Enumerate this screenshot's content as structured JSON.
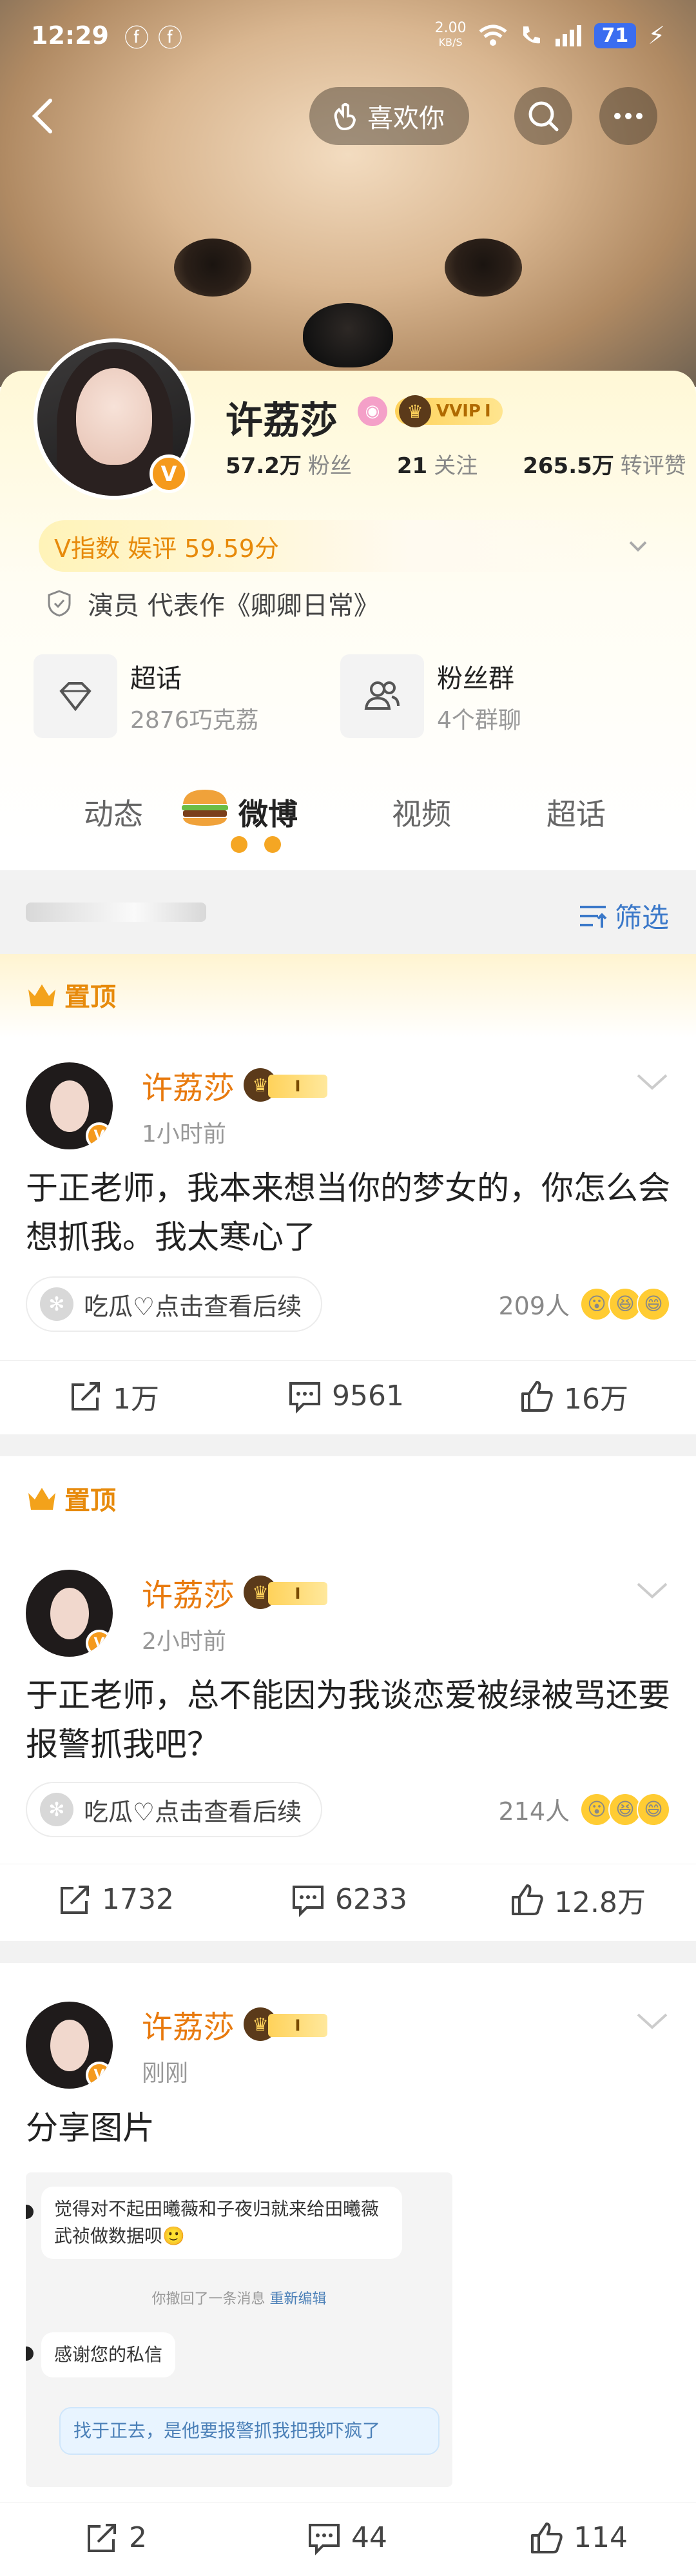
{
  "status_bar": {
    "time": "12:29",
    "net_speed": "2.00",
    "net_unit": "KB/S",
    "battery": "71"
  },
  "top_nav": {
    "like_label": "喜欢你"
  },
  "profile": {
    "name": "许荔莎",
    "vip_label": "VVIP",
    "vip_level": "I",
    "followers_count": "57.2万",
    "followers_label": "粉丝",
    "following_count": "21",
    "following_label": "关注",
    "likes_count": "265.5万",
    "likes_label": "转评赞",
    "v_index": "V指数 娱评 59.59分",
    "occupation": "演员 代表作《卿卿日常》",
    "supertopic": {
      "title": "超话",
      "sub": "2876巧克荔"
    },
    "fangroup": {
      "title": "粉丝群",
      "sub": "4个群聊"
    }
  },
  "tabs": [
    {
      "label": "动态"
    },
    {
      "label": "微博"
    },
    {
      "label": "视频"
    },
    {
      "label": "超话"
    }
  ],
  "filter_label": "筛选",
  "pinned_label": "置顶",
  "posts": [
    {
      "pinned": true,
      "user": "许荔莎",
      "level": "I",
      "time": "1小时前",
      "text": "于正老师，我本来想当你的梦女的，你怎么会想抓我。我太寒心了",
      "melon": "吃瓜♡点击查看后续",
      "reactors": "209人",
      "shares": "1万",
      "comments": "9561",
      "likes": "16万"
    },
    {
      "pinned": true,
      "user": "许荔莎",
      "level": "I",
      "time": "2小时前",
      "text": "于正老师，总不能因为我谈恋爱被绿被骂还要报警抓我吧？",
      "melon": "吃瓜♡点击查看后续",
      "reactors": "214人",
      "shares": "1732",
      "comments": "6233",
      "likes": "12.8万"
    },
    {
      "pinned": false,
      "user": "许荔莎",
      "level": "I",
      "time": "刚刚",
      "text": "分享图片",
      "shares": "2",
      "comments": "44",
      "likes": "114"
    }
  ],
  "shared_image": {
    "msg1": "觉得对不起田曦薇和子夜归就来给田曦薇武祯做数据呗🙂",
    "sys_text": "你撤回了一条消息",
    "sys_link": "重新编辑",
    "msg2": "感谢您的私信",
    "msg3": "找于正去，是他要报警抓我把我吓疯了"
  },
  "colors": {
    "accent_orange": "#e87a0e",
    "link_blue": "#3a78c9",
    "vip_gold": "#ffd25a"
  }
}
